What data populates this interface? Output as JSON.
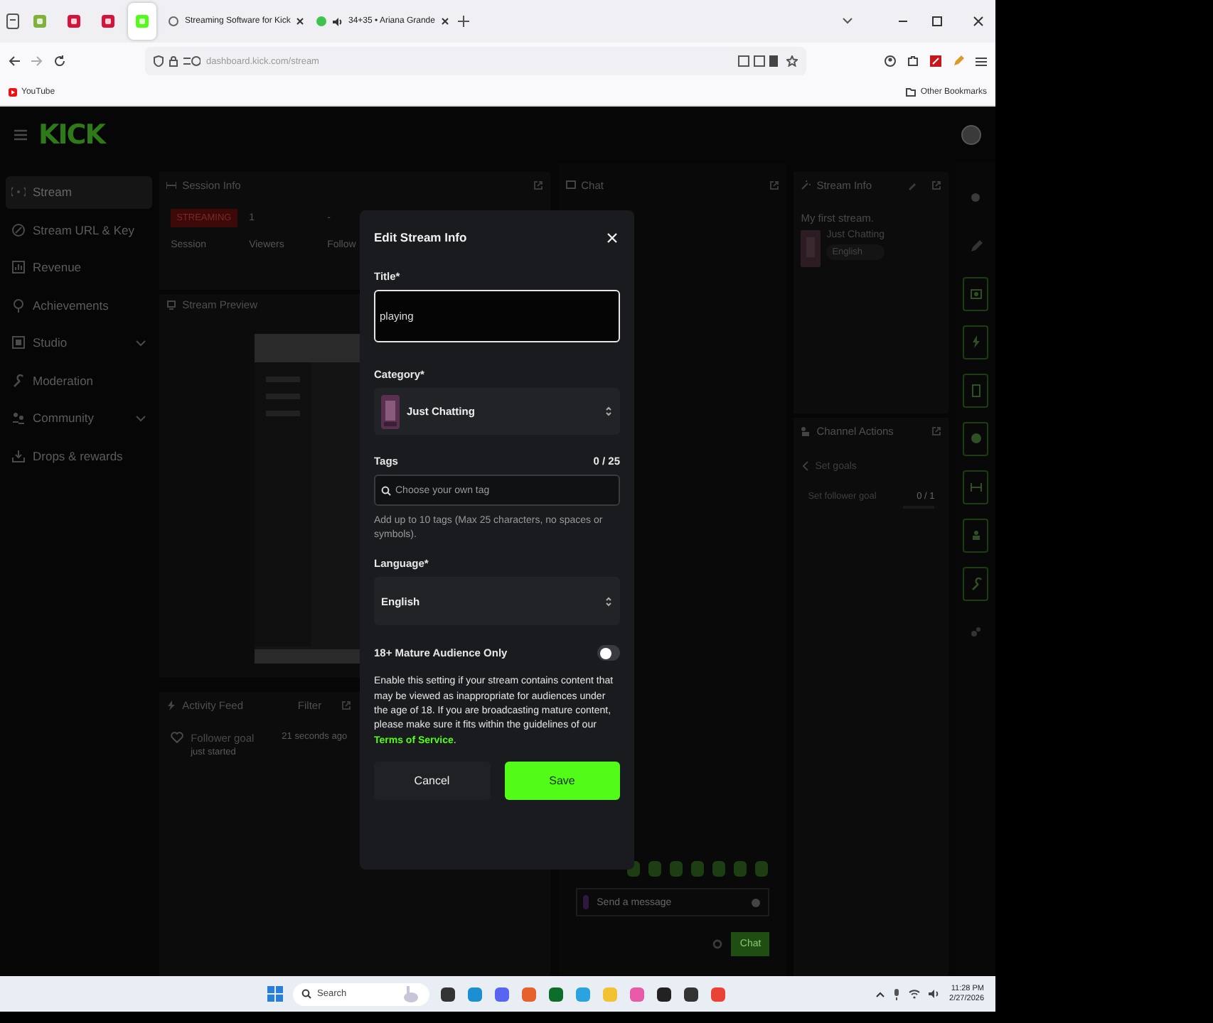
{
  "browser": {
    "tabs": [
      {
        "kind": "pinned",
        "selected": false
      },
      {
        "kind": "pinned",
        "selected": false
      },
      {
        "kind": "pinned",
        "selected": false
      },
      {
        "kind": "pinned",
        "selected": true
      },
      {
        "kind": "tab",
        "title": "Streaming Software for Kick",
        "selected": false,
        "audio": false
      },
      {
        "kind": "tab",
        "title": "34+35 • Ariana Grande",
        "selected": false,
        "audio": true
      }
    ],
    "url": "dashboard.kick.com/stream",
    "bookmarks": [
      "YouTube"
    ],
    "other_bookmarks": "Other Bookmarks"
  },
  "dashboard": {
    "logo": "KICK",
    "sidebar": {
      "items": [
        {
          "label": "Stream",
          "selected": true,
          "has_submenu": false
        },
        {
          "label": "Stream URL & Key",
          "selected": false,
          "has_submenu": false
        },
        {
          "label": "Revenue",
          "selected": false,
          "has_submenu": false
        },
        {
          "label": "Achievements",
          "selected": false,
          "has_submenu": false
        },
        {
          "label": "Studio",
          "selected": false,
          "has_submenu": true
        },
        {
          "label": "Moderation",
          "selected": false,
          "has_submenu": false
        },
        {
          "label": "Community",
          "selected": false,
          "has_submenu": true
        },
        {
          "label": "Drops & rewards",
          "selected": false,
          "has_submenu": false
        }
      ]
    },
    "session_info": {
      "title": "Session Info",
      "stats": [
        {
          "kind": "badge",
          "value": "STREAMING",
          "label": "Session"
        },
        {
          "kind": "plain",
          "value": "1",
          "label": "Viewers"
        },
        {
          "kind": "plain",
          "value": "-",
          "label": "Follow"
        }
      ]
    },
    "stream_preview": {
      "title": "Stream Preview",
      "kind": "picture"
    },
    "activity_feed": {
      "title": "Activity Feed",
      "filter": "Filter",
      "events": [
        {
          "title": "Follower goal",
          "subtitle": "just started",
          "time": "21 seconds ago"
        }
      ]
    },
    "chat": {
      "title": "Chat",
      "placeholder": "Send a message",
      "send": "Chat"
    },
    "stream_info": {
      "title": "Stream Info",
      "stream_title": "My first stream.",
      "category": "Just Chatting",
      "language": "English"
    },
    "channel_actions": {
      "title": "Channel Actions",
      "back": "Set goals",
      "goals": [
        {
          "label": "Set follower goal",
          "progress": "0 / 1",
          "level": 0
        }
      ]
    }
  },
  "modal": {
    "title": "Edit Stream Info",
    "title_field": {
      "label": "Title*",
      "value": "playing"
    },
    "category": {
      "label": "Category*",
      "value": "Just Chatting"
    },
    "tags": {
      "label": "Tags",
      "count": "0 / 25",
      "placeholder": "Choose your own tag",
      "hint": "Add up to 10 tags (Max 25 characters, no spaces or symbols)."
    },
    "language": {
      "label": "Language*",
      "value": "English"
    },
    "mature": {
      "label": "18+ Mature Audience Only",
      "on": false
    },
    "notice": {
      "text": "Enable this setting if your stream contains content that may be viewed as inappropriate for audiences under the age of 18. If you are broadcasting mature content, please make sure it fits within the guidelines of our ",
      "link": "Terms of Service",
      "end": "."
    },
    "buttons": {
      "cancel": "Cancel",
      "save": "Save"
    }
  },
  "taskbar": {
    "search": "Search",
    "time": "11:28 PM",
    "date": "2/27/2026"
  }
}
